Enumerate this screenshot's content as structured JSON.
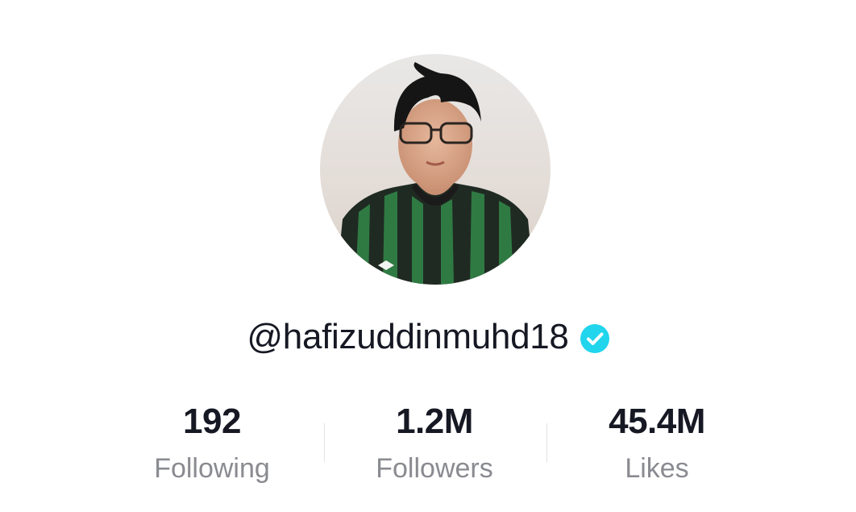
{
  "profile": {
    "username": "@hafizuddinmuhd18",
    "verified": true,
    "verified_color": "#20d5ec",
    "avatar_icon": "profile-photo"
  },
  "stats": {
    "following": {
      "value": "192",
      "label": "Following"
    },
    "followers": {
      "value": "1.2M",
      "label": "Followers"
    },
    "likes": {
      "value": "45.4M",
      "label": "Likes"
    }
  }
}
